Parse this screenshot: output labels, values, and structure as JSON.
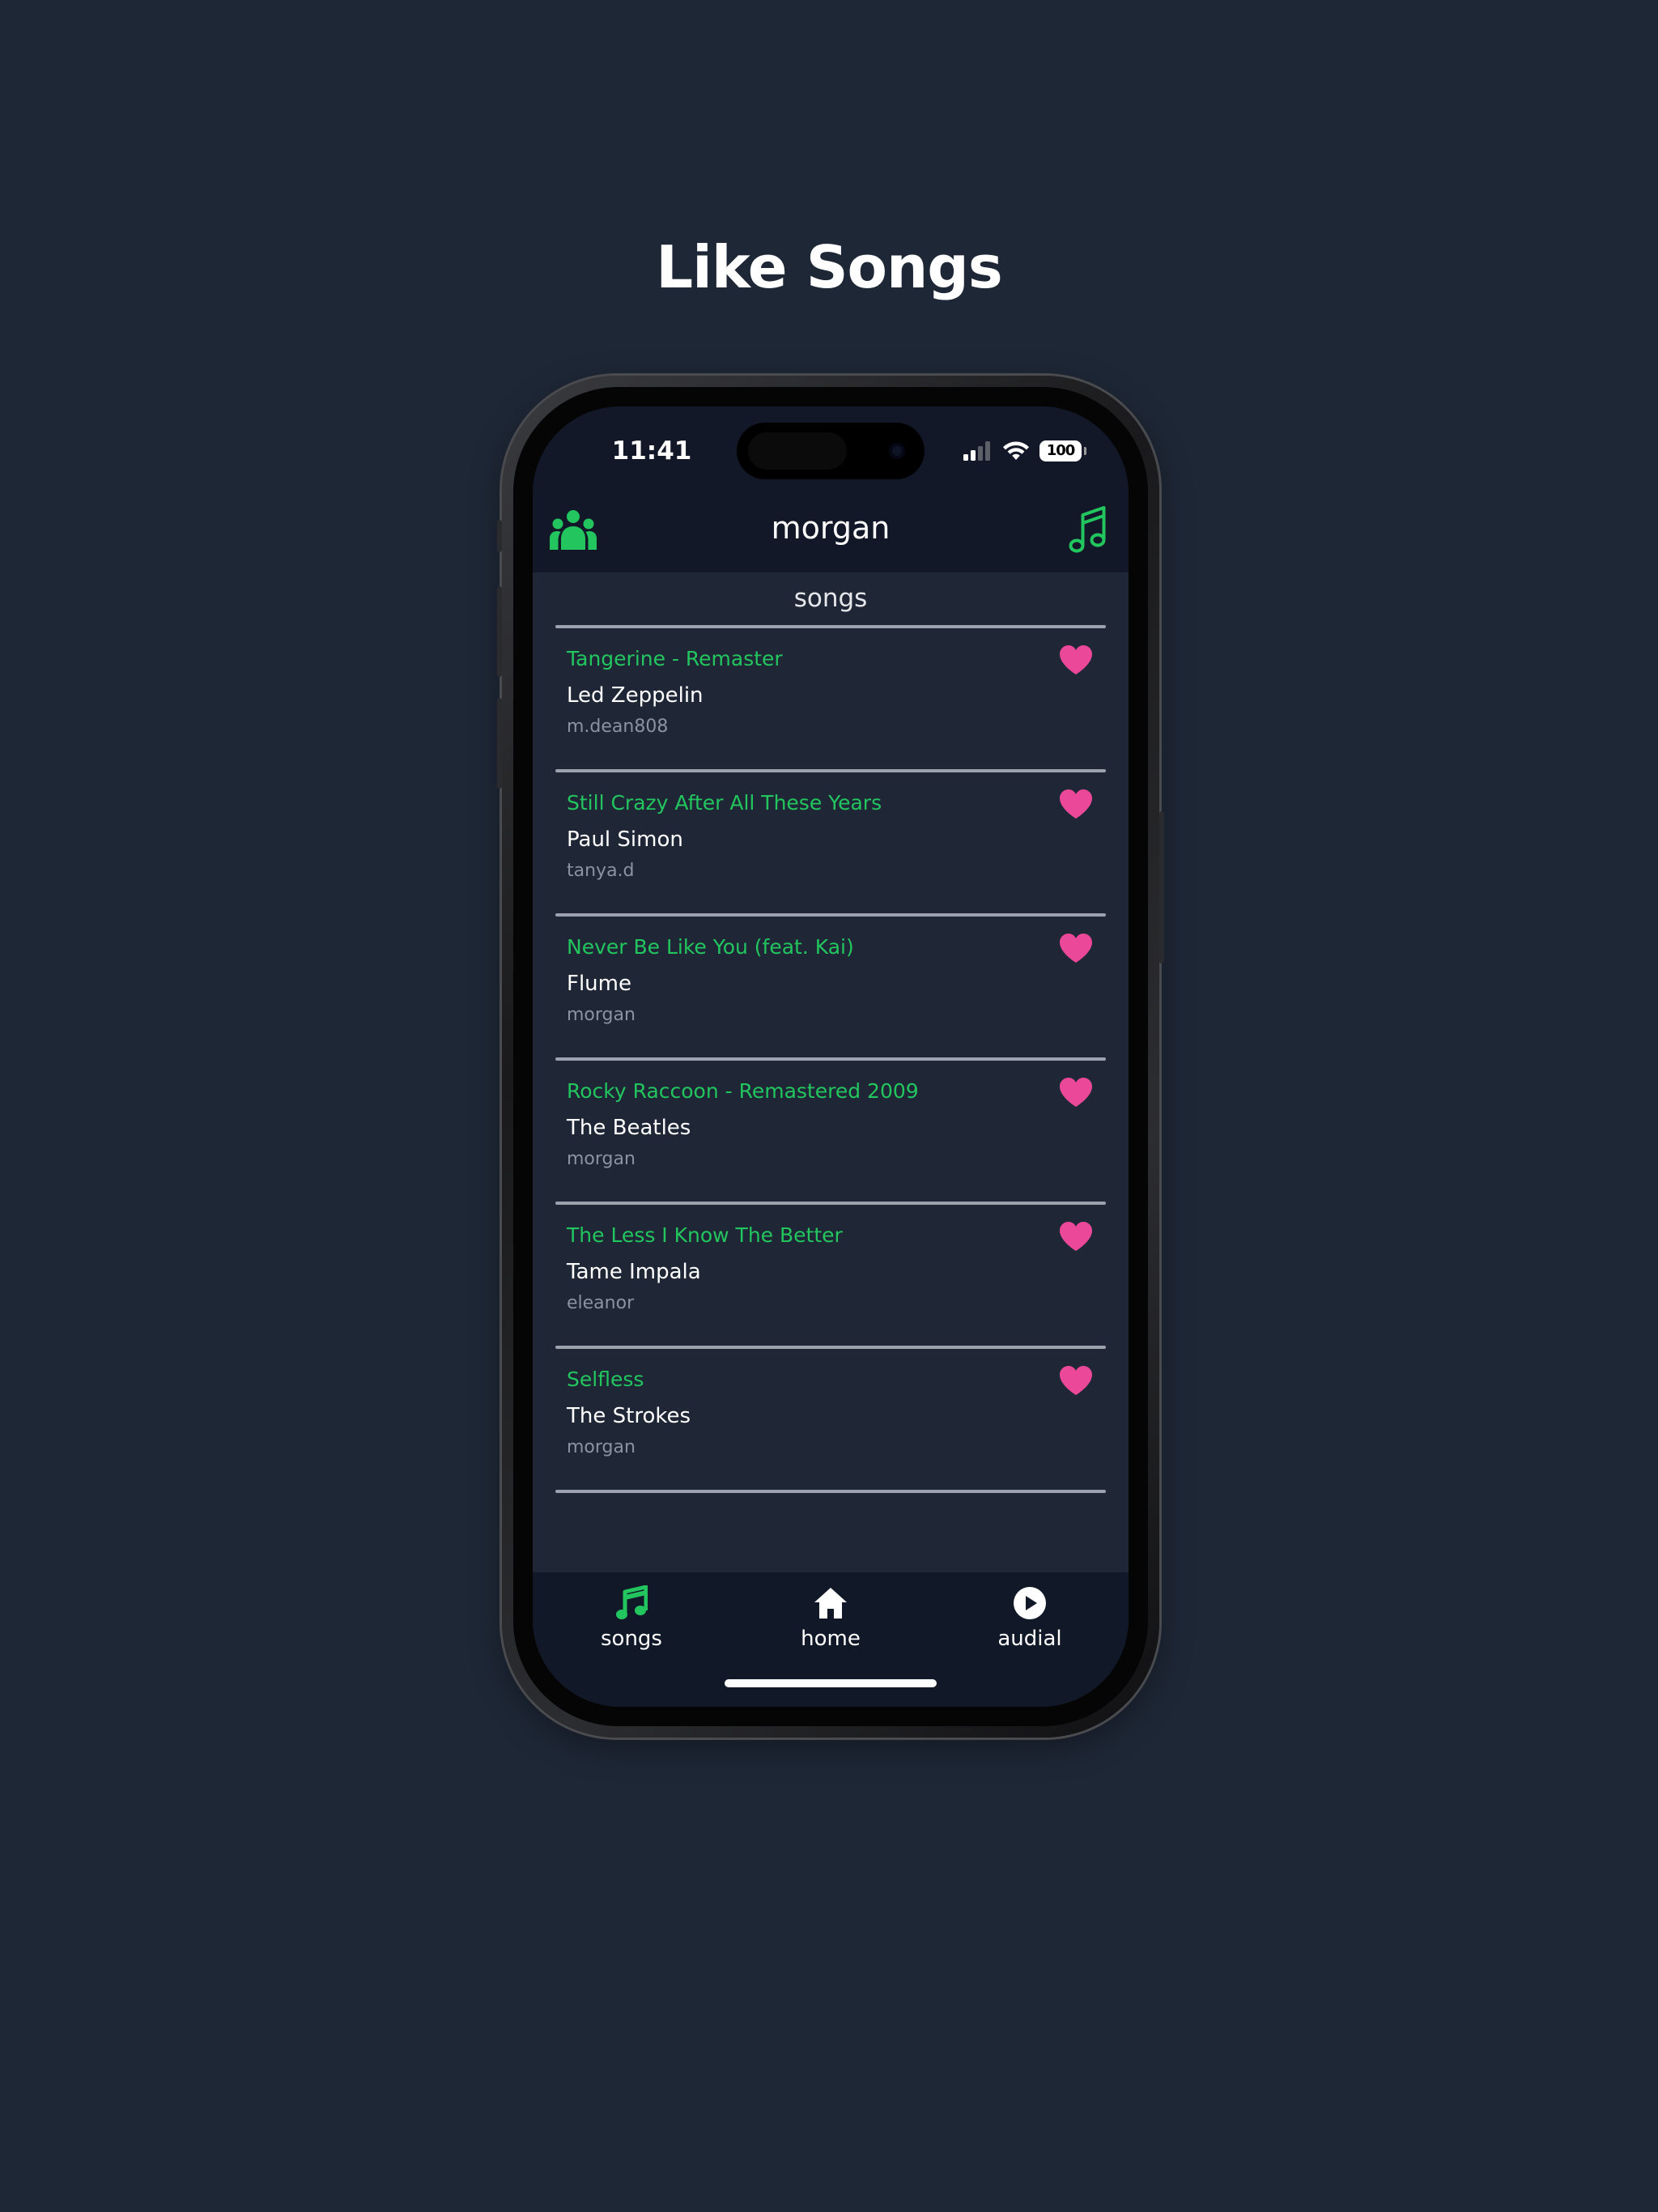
{
  "page": {
    "headline": "Like Songs"
  },
  "status_bar": {
    "time": "11:41",
    "battery": "100"
  },
  "header": {
    "title": "morgan",
    "left_icon": "friends-icon",
    "right_icon": "music-note-icon"
  },
  "section": {
    "label": "songs"
  },
  "songs": [
    {
      "title": "Tangerine - Remaster",
      "artist": "Led Zeppelin",
      "user": "m.dean808",
      "liked": true
    },
    {
      "title": "Still Crazy After All These Years",
      "artist": "Paul Simon",
      "user": "tanya.d",
      "liked": true
    },
    {
      "title": "Never Be Like You (feat. Kai)",
      "artist": "Flume",
      "user": "morgan",
      "liked": true
    },
    {
      "title": "Rocky Raccoon - Remastered 2009",
      "artist": "The Beatles",
      "user": "morgan",
      "liked": true
    },
    {
      "title": "The Less I Know The Better",
      "artist": "Tame Impala",
      "user": "eleanor",
      "liked": true
    },
    {
      "title": "Selfless",
      "artist": "The Strokes",
      "user": "morgan",
      "liked": true
    }
  ],
  "tabbar": {
    "tabs": [
      {
        "label": "songs",
        "icon": "music-note-icon",
        "active": true
      },
      {
        "label": "home",
        "icon": "home-icon",
        "active": false
      },
      {
        "label": "audial",
        "icon": "play-circle-icon",
        "active": false
      }
    ]
  },
  "colors": {
    "background": "#1e2736",
    "accent_green": "#22c55e",
    "heart_pink": "#ec4899",
    "header_bg": "#121827",
    "divider": "#9ca3af"
  }
}
